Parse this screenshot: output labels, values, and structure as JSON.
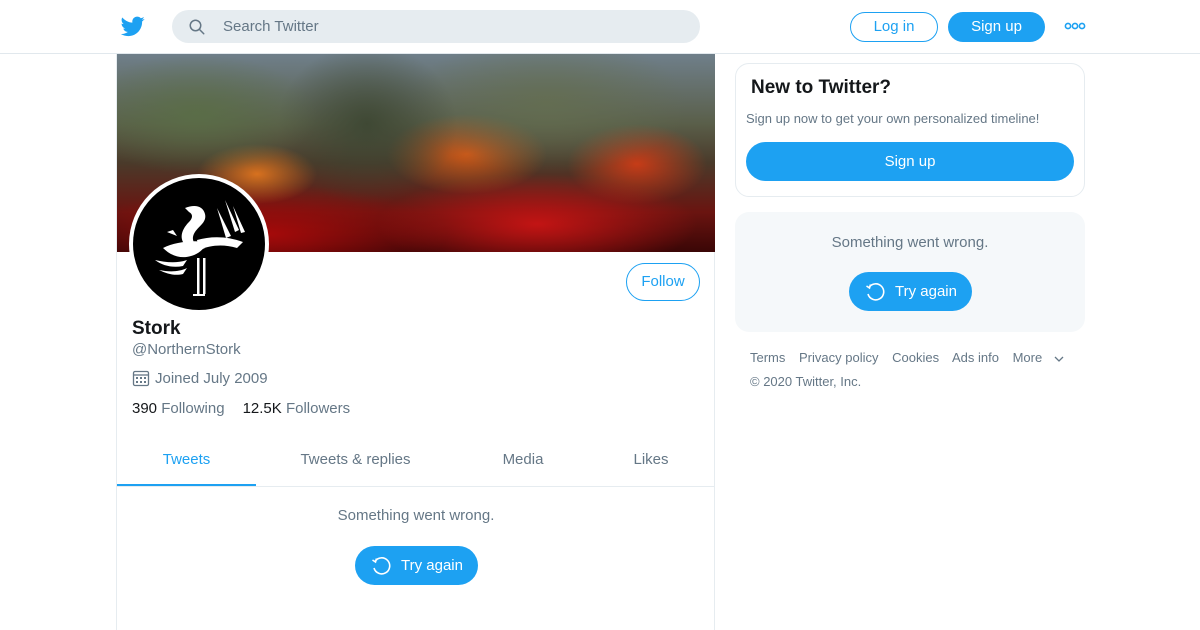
{
  "header": {
    "search_placeholder": "Search Twitter",
    "login_label": "Log in",
    "signup_label": "Sign up"
  },
  "profile": {
    "name": "Stork",
    "handle": "@NorthernStork",
    "joined": "Joined July 2009",
    "following_count": "390",
    "following_label": "Following",
    "followers_count": "12.5K",
    "followers_label": "Followers",
    "follow_label": "Follow"
  },
  "tabs": [
    {
      "label": "Tweets",
      "active": true
    },
    {
      "label": "Tweets & replies",
      "active": false
    },
    {
      "label": "Media",
      "active": false
    },
    {
      "label": "Likes",
      "active": false
    }
  ],
  "timeline": {
    "error_message": "Something went wrong.",
    "retry_label": "Try again"
  },
  "sidebar": {
    "new_title": "New to Twitter?",
    "new_subtitle": "Sign up now to get your own personalized timeline!",
    "new_signup_label": "Sign up",
    "error_message": "Something went wrong.",
    "retry_label": "Try again"
  },
  "footer": {
    "links": [
      "Terms",
      "Privacy policy",
      "Cookies",
      "Ads info",
      "More"
    ],
    "copyright": "© 2020 Twitter, Inc."
  },
  "colors": {
    "accent": "#1da1f2",
    "secondary_text": "#657786",
    "panel_bg": "#f5f8fa"
  },
  "icons": [
    "twitter-bird-icon",
    "search-icon",
    "more-dots-icon",
    "calendar-icon",
    "refresh-icon",
    "chevron-down-icon"
  ]
}
